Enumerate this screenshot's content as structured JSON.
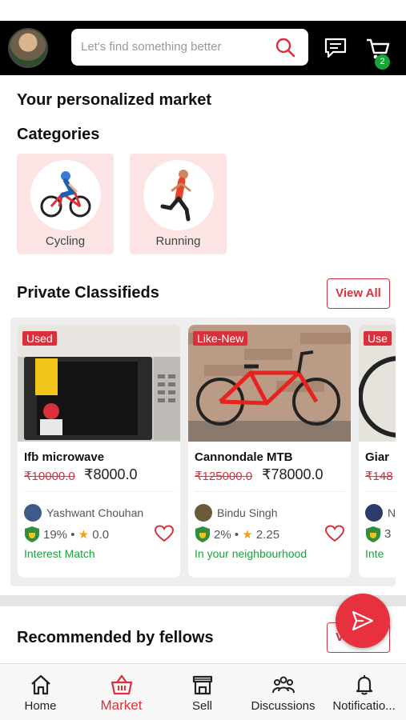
{
  "header": {
    "search_placeholder": "Let's find something better",
    "cart_count": "2"
  },
  "page": {
    "title": "Your personalized market",
    "categories_heading": "Categories",
    "categories": [
      {
        "label": "Cycling",
        "icon": "cyclist-icon"
      },
      {
        "label": "Running",
        "icon": "runner-icon"
      }
    ],
    "classifieds_heading": "Private Classifieds",
    "view_all_label": "View All",
    "recommended_heading": "Recommended by fellows"
  },
  "listings": [
    {
      "condition": "Used",
      "title": "Ifb microwave",
      "mrp": "₹10000.0",
      "price": "₹8000.0",
      "seller": "Yashwant Chouhan",
      "match": "19%",
      "rating": "0.0",
      "tag": "Interest Match"
    },
    {
      "condition": "Like-New",
      "title": "Cannondale MTB",
      "mrp": "₹125000.0",
      "price": "₹78000.0",
      "seller": "Bindu Singh",
      "match": "2%",
      "rating": "2.25",
      "tag": "In your neighbourhood"
    },
    {
      "condition": "Use",
      "title": "Giar",
      "mrp": "₹148",
      "price": "",
      "seller": "N",
      "match": "3",
      "rating": "",
      "tag": "Inte"
    }
  ],
  "tabbar": {
    "items": [
      {
        "label": "Home",
        "icon": "home-icon"
      },
      {
        "label": "Market",
        "icon": "basket-icon",
        "active": true
      },
      {
        "label": "Sell",
        "icon": "shop-icon"
      },
      {
        "label": "Discussions",
        "icon": "group-icon"
      },
      {
        "label": "Notificatio...",
        "icon": "bell-icon"
      }
    ]
  },
  "colors": {
    "accent": "#d8313c",
    "green": "#1aa33a",
    "category_bg": "#fde4e4"
  }
}
